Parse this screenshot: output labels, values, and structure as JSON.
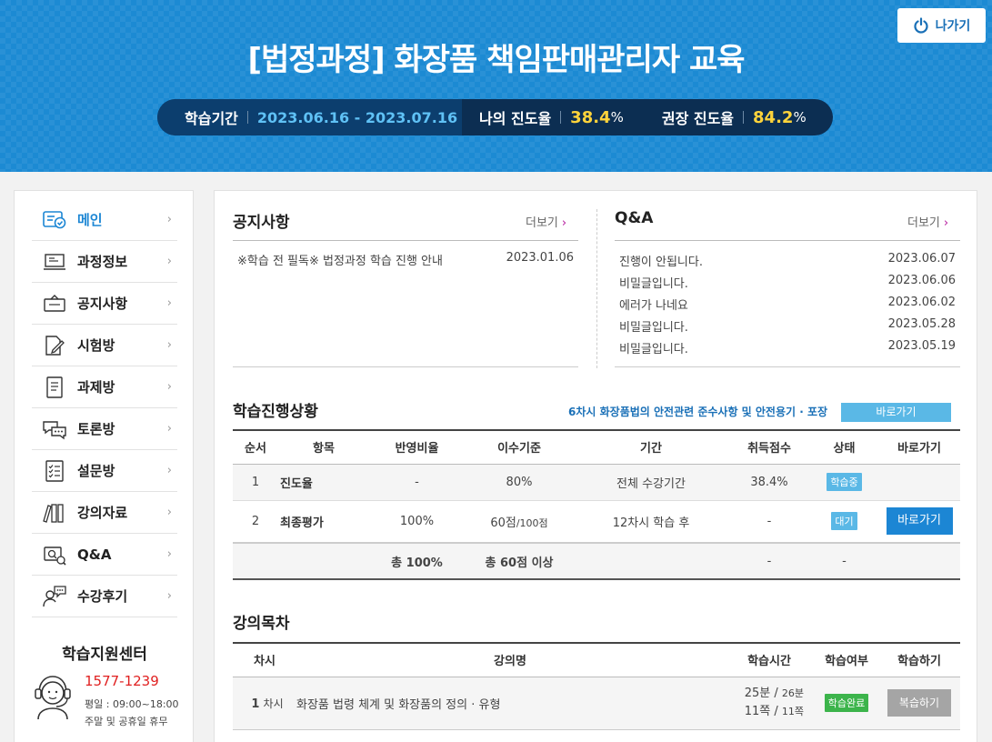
{
  "header": {
    "title": "[법정과정] 화장품 책임판매관리자 교육",
    "exit_label": "나가기",
    "period_label": "학습기간",
    "period_value": "2023.06.16 - 2023.07.16",
    "my_progress_label": "나의 진도율",
    "my_progress_value": "38.4",
    "recommended_label": "권장 진도율",
    "recommended_value": "84.2",
    "percent_unit": "%"
  },
  "sidebar": {
    "items": [
      {
        "label": "메인",
        "icon": "main-icon"
      },
      {
        "label": "과정정보",
        "icon": "monitor-icon"
      },
      {
        "label": "공지사항",
        "icon": "notice-icon"
      },
      {
        "label": "시험방",
        "icon": "exam-icon"
      },
      {
        "label": "과제방",
        "icon": "assignment-icon"
      },
      {
        "label": "토론방",
        "icon": "discussion-icon"
      },
      {
        "label": "설문방",
        "icon": "survey-icon"
      },
      {
        "label": "강의자료",
        "icon": "books-icon"
      },
      {
        "label": "Q&A",
        "icon": "qa-icon"
      },
      {
        "label": "수강후기",
        "icon": "review-icon"
      }
    ],
    "chevron": "›",
    "support": {
      "title": "학습지원센터",
      "phone": "1577-1239",
      "hours_weekday": "평일 : 09:00~18:00",
      "hours_weekend": "주말 및 공휴일 휴무"
    }
  },
  "notice": {
    "title": "공지사항",
    "more": "더보기",
    "items": [
      {
        "title": "※학습 전 필독※ 법정과정 학습 진행 안내",
        "date": "2023.01.06"
      }
    ]
  },
  "qa": {
    "title": "Q&A",
    "more": "더보기",
    "items": [
      {
        "title": "진행이 안됩니다.",
        "date": "2023.06.07"
      },
      {
        "title": "비밀글입니다.",
        "date": "2023.06.06"
      },
      {
        "title": "에러가 나네요",
        "date": "2023.06.02"
      },
      {
        "title": "비밀글입니다.",
        "date": "2023.05.28"
      },
      {
        "title": "비밀글입니다.",
        "date": "2023.05.19"
      }
    ]
  },
  "progress": {
    "title": "학습진행상황",
    "notice_text": "6차시 화장품법의 안전관련 준수사항 및 안전용기 · 포장",
    "notice_button": "바로가기",
    "headers": [
      "순서",
      "항목",
      "반영비율",
      "이수기준",
      "기간",
      "취득점수",
      "상태",
      "바로가기"
    ],
    "rows": [
      {
        "no": "1",
        "item": "진도율",
        "ratio": "-",
        "criteria": "80%",
        "criteria_small": "",
        "period": "전체 수강기간",
        "score": "38.4%",
        "status": "학습중",
        "status_color": "#5ab8e6",
        "go": ""
      },
      {
        "no": "2",
        "item": "최종평가",
        "ratio": "100%",
        "criteria": "60점",
        "criteria_small": "/100점",
        "period": "12차시 학습 후",
        "score": "-",
        "status": "대기",
        "status_color": "#5ab8e6",
        "go": "바로가기"
      }
    ],
    "total": {
      "ratio": "총 100%",
      "criteria": "총 60점 이상",
      "score": "-",
      "status": "-"
    }
  },
  "lectures": {
    "title": "강의목차",
    "headers": [
      "차시",
      "강의명",
      "학습시간",
      "학습여부",
      "학습하기"
    ],
    "rows": [
      {
        "no": "1",
        "no_unit": "차시",
        "name": "화장품 법령 체계 및 화장품의 정의 · 유형",
        "time": "25분",
        "time_total": "26분",
        "pages": "11쪽",
        "pages_total": "11쪽",
        "sep": "/",
        "status": "학습완료",
        "status_color": "#3cb44b",
        "action": "복습하기"
      }
    ]
  },
  "colors": {
    "brand_blue": "#1c8ad3",
    "pill_dark": "#0c2e52",
    "accent_yellow": "#ffd43b",
    "link_blue": "#1a70b7",
    "danger_red": "#e02020"
  }
}
